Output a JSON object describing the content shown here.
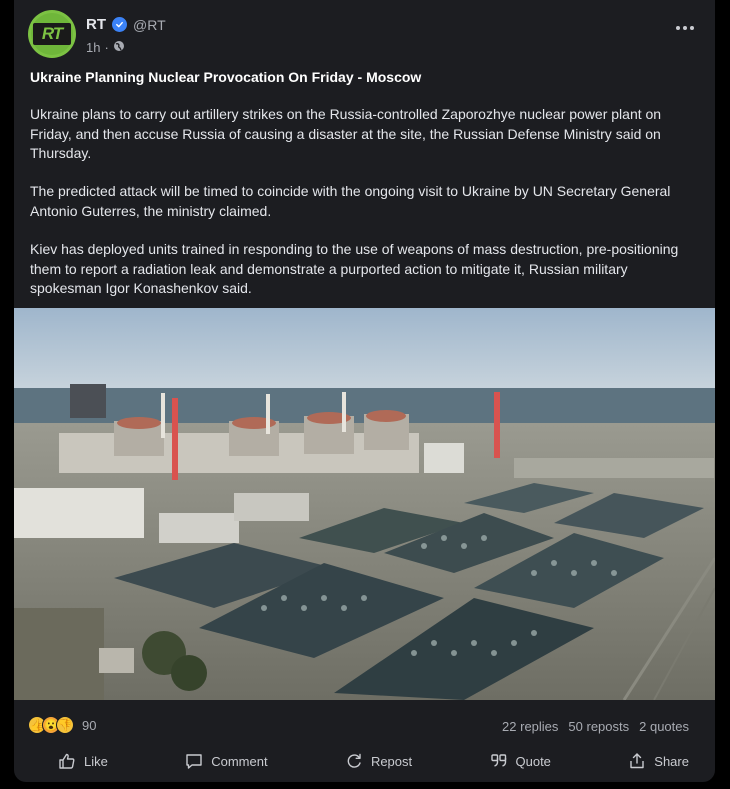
{
  "author": {
    "name": "RT",
    "handle": "@RT",
    "avatar_text": "RT",
    "time": "1h",
    "separator": "·",
    "verified": true
  },
  "post": {
    "title": "Ukraine Planning Nuclear Provocation On Friday - Moscow",
    "paragraphs": [
      "Ukraine plans to carry out artillery strikes on the Russia-controlled Zaporozhye nuclear power plant on Friday, and then accuse Russia of causing a disaster at the site, the Russian Defense Ministry said on Thursday.",
      "The predicted attack will be timed to coincide with the ongoing visit to Ukraine by UN Secretary General Antonio Guterres, the ministry claimed.",
      "Kiev has deployed units trained in responding to the use of weapons of mass destruction, pre-positioning them to report a radiation leak and demonstrate a purported action to mitigate it, Russian military spokesman Igor Konashenkov said."
    ]
  },
  "engagement": {
    "reaction_count": "90",
    "replies": "22 replies",
    "reposts": "50 reposts",
    "quotes": "2 quotes"
  },
  "actions": {
    "like": "Like",
    "comment": "Comment",
    "repost": "Repost",
    "quote": "Quote",
    "share": "Share"
  },
  "colors": {
    "background": "#000000",
    "card": "#1c1d21",
    "accent_verified": "#3b82f6",
    "brand_green": "#7cc243"
  },
  "icons": [
    "verified-badge-icon",
    "globe-icon",
    "more-icon",
    "thumbs-up-icon",
    "comment-icon",
    "repost-icon",
    "quote-icon",
    "share-icon"
  ]
}
